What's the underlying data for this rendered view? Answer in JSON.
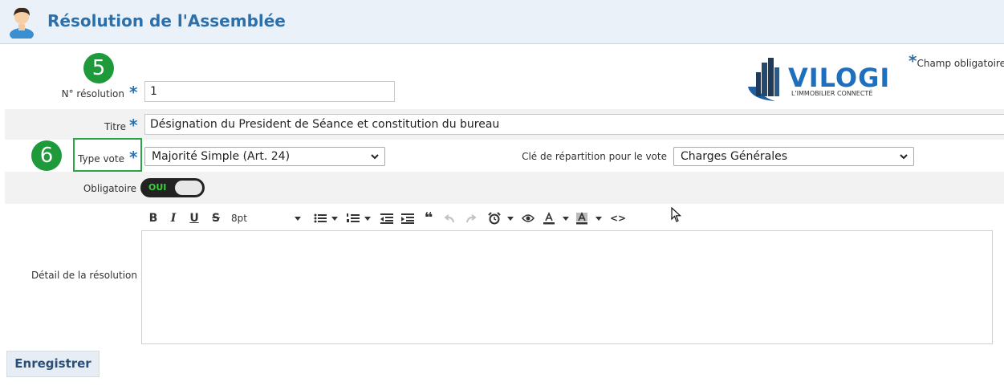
{
  "header": {
    "title": "Résolution de l'Assemblée"
  },
  "required_note": {
    "star": "*",
    "label": "Champ obligatoire"
  },
  "logo": {
    "text": "VILOGI",
    "tagline": "L'IMMOBILIER CONNECTÉ"
  },
  "annotations": {
    "step5": "5",
    "step6": "6"
  },
  "fields": {
    "resolution_number": {
      "label": "N° résolution",
      "value": "1"
    },
    "titre": {
      "label": "Titre",
      "value": "Désignation du President de Séance et constitution du bureau"
    },
    "type_vote": {
      "label": "Type vote",
      "selected": "Majorité Simple (Art. 24)"
    },
    "cle_repartition": {
      "label": "Clé de répartition pour le vote",
      "selected": "Charges Générales"
    },
    "obligatoire": {
      "label": "Obligatoire",
      "toggle_text": "OUI",
      "checked": true
    },
    "detail": {
      "label": "Détail de la résolution",
      "value": ""
    }
  },
  "editor_toolbar": {
    "bold": "B",
    "italic": "I",
    "underline": "U",
    "strike": "S",
    "font_size": "8pt",
    "quote": "❝",
    "code": "<>"
  },
  "actions": {
    "save_label": "Enregistrer"
  },
  "colors": {
    "accent": "#2d6fa8",
    "badge": "#1e9a3b",
    "toggle_on_text": "#38d13a"
  }
}
